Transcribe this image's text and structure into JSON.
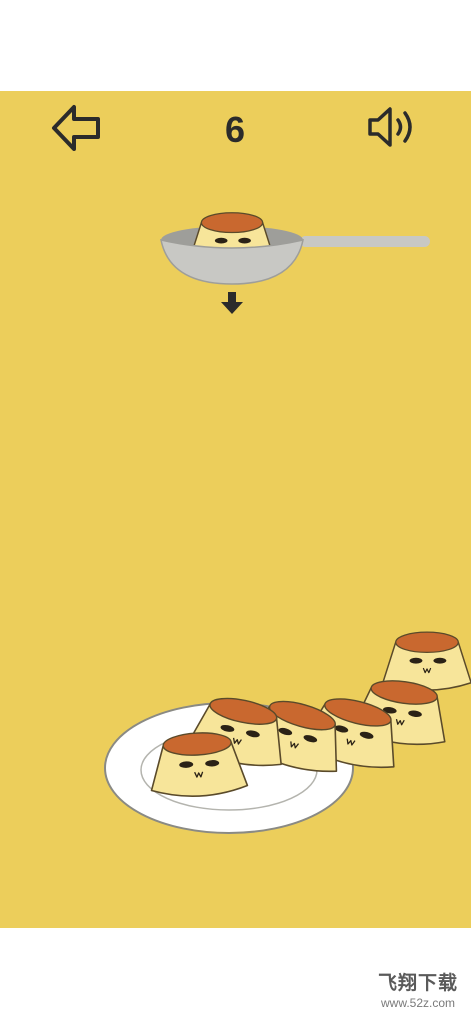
{
  "hud": {
    "score": "6",
    "back_icon": "back-arrow-icon",
    "sound_icon": "speaker-icon"
  },
  "colors": {
    "background": "#ecce5b",
    "pudding_body": "#f7e59a",
    "caramel": "#c9682f",
    "plate": "#ffffff",
    "spoon": "#c8c8c4"
  },
  "game": {
    "puddings_on_spoon": 1,
    "puddings_stacked": 6
  },
  "watermark": {
    "title": "飞翔下载",
    "url": "www.52z.com"
  }
}
